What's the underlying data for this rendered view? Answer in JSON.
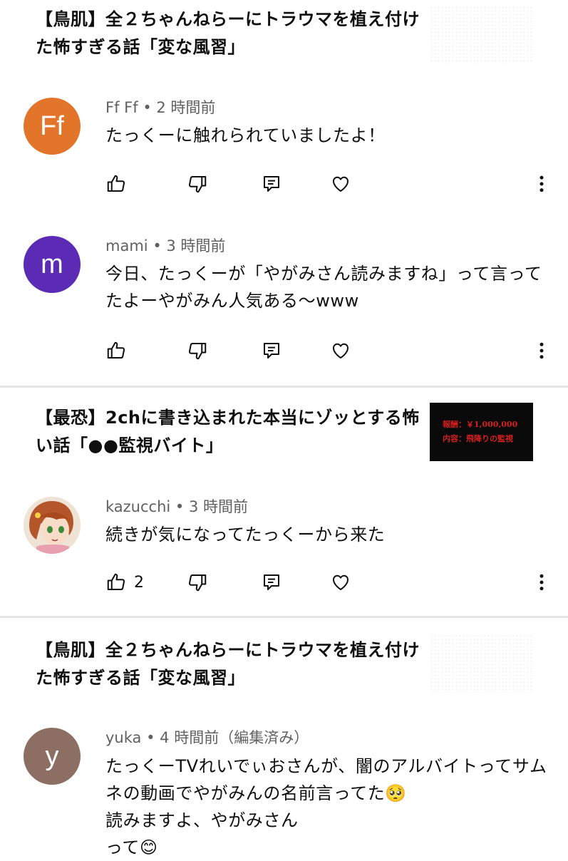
{
  "colors": {
    "avatar_ff": "#e3752b",
    "avatar_mami": "#5b2bb5",
    "avatar_yuka": "#8d6e63",
    "meta_text": "#606060",
    "divider": "#e5e5e5",
    "thumb_text": "#d61f1f"
  },
  "groups": [
    {
      "video_title": "【鳥肌】全２ちゃんねらーにトラウマを植え付けた怖すぎる話「変な風習」",
      "comments": [
        {
          "avatar_letter": "Ff",
          "author": "Ff Ff",
          "time": "2 時間前",
          "text": "たっくーに触れられていましたよ！",
          "likes": ""
        },
        {
          "avatar_letter": "m",
          "author": "mami",
          "time": "3 時間前",
          "text": "今日、たっくーが「やがみさん読みますね」って言ってたよーやがみん人気ある〜www",
          "likes": ""
        }
      ]
    },
    {
      "video_title": "【最恐】2chに書き込まれた本当にゾッとする怖い話「●●監視バイト」",
      "thumbnail": {
        "line1": "報酬：￥1,000,000",
        "line2": "内容：飛降りの監視"
      },
      "comments": [
        {
          "avatar_letter": "",
          "avatar_icon": "anime-character-avatar",
          "author": "kazucchi",
          "time": "3 時間前",
          "text": "続きが気になってたっくーから来た",
          "likes": "2"
        }
      ]
    },
    {
      "video_title": "【鳥肌】全２ちゃんねらーにトラウマを植え付けた怖すぎる話「変な風習」",
      "comments": [
        {
          "avatar_letter": "y",
          "author": "yuka",
          "time": "4 時間前（編集済み）",
          "text": "たっくーTVれいでぃおさんが、闇のアルバイトってサムネの動画でやがみんの名前言ってた🥺\n読みますよ、やがみさん\nって😊",
          "likes": ""
        }
      ]
    }
  ],
  "icons": {
    "like": "thumbs-up-icon",
    "dislike": "thumbs-down-icon",
    "reply": "reply-comment-icon",
    "heart": "heart-icon",
    "more": "more-vertical-icon",
    "separator": "•"
  }
}
